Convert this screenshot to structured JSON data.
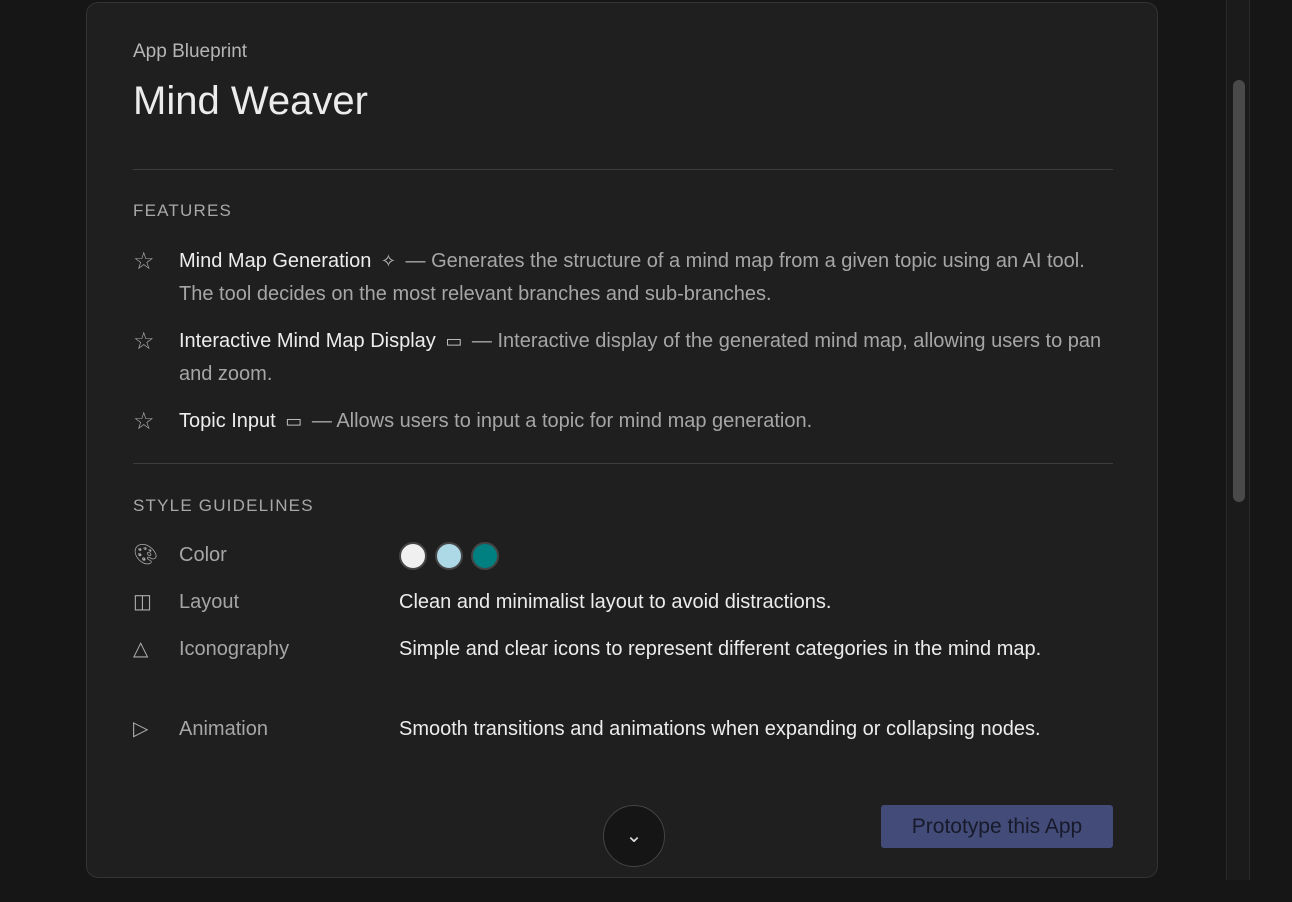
{
  "header": {
    "subtitle": "App Blueprint",
    "title": "Mind Weaver"
  },
  "features": {
    "heading": "FEATURES",
    "items": [
      {
        "name": "Mind Map Generation",
        "icon": "sparkle-icon",
        "desc": "— Generates the structure of a mind map from a given topic using an AI tool. The tool decides on the most relevant branches and sub-branches."
      },
      {
        "name": "Interactive Mind Map Display",
        "icon": "window-icon",
        "desc": "— Interactive display of the generated mind map, allowing users to pan and zoom."
      },
      {
        "name": "Topic Input",
        "icon": "window-icon",
        "desc": "— Allows users to input a topic for mind map generation."
      }
    ]
  },
  "style": {
    "heading": "STYLE GUIDELINES",
    "color_label": "Color",
    "colors": [
      "#F0F0F0",
      "#ADD8E6",
      "#008080"
    ],
    "rows": [
      {
        "label": "Layout",
        "value": "Clean and minimalist layout to avoid distractions."
      },
      {
        "label": "Iconography",
        "value": "Simple and clear icons to represent different categories in the mind map."
      },
      {
        "label": "Animation",
        "value": "Smooth transitions and animations when expanding or collapsing nodes."
      }
    ]
  },
  "actions": {
    "prototype": "Prototype this App"
  }
}
